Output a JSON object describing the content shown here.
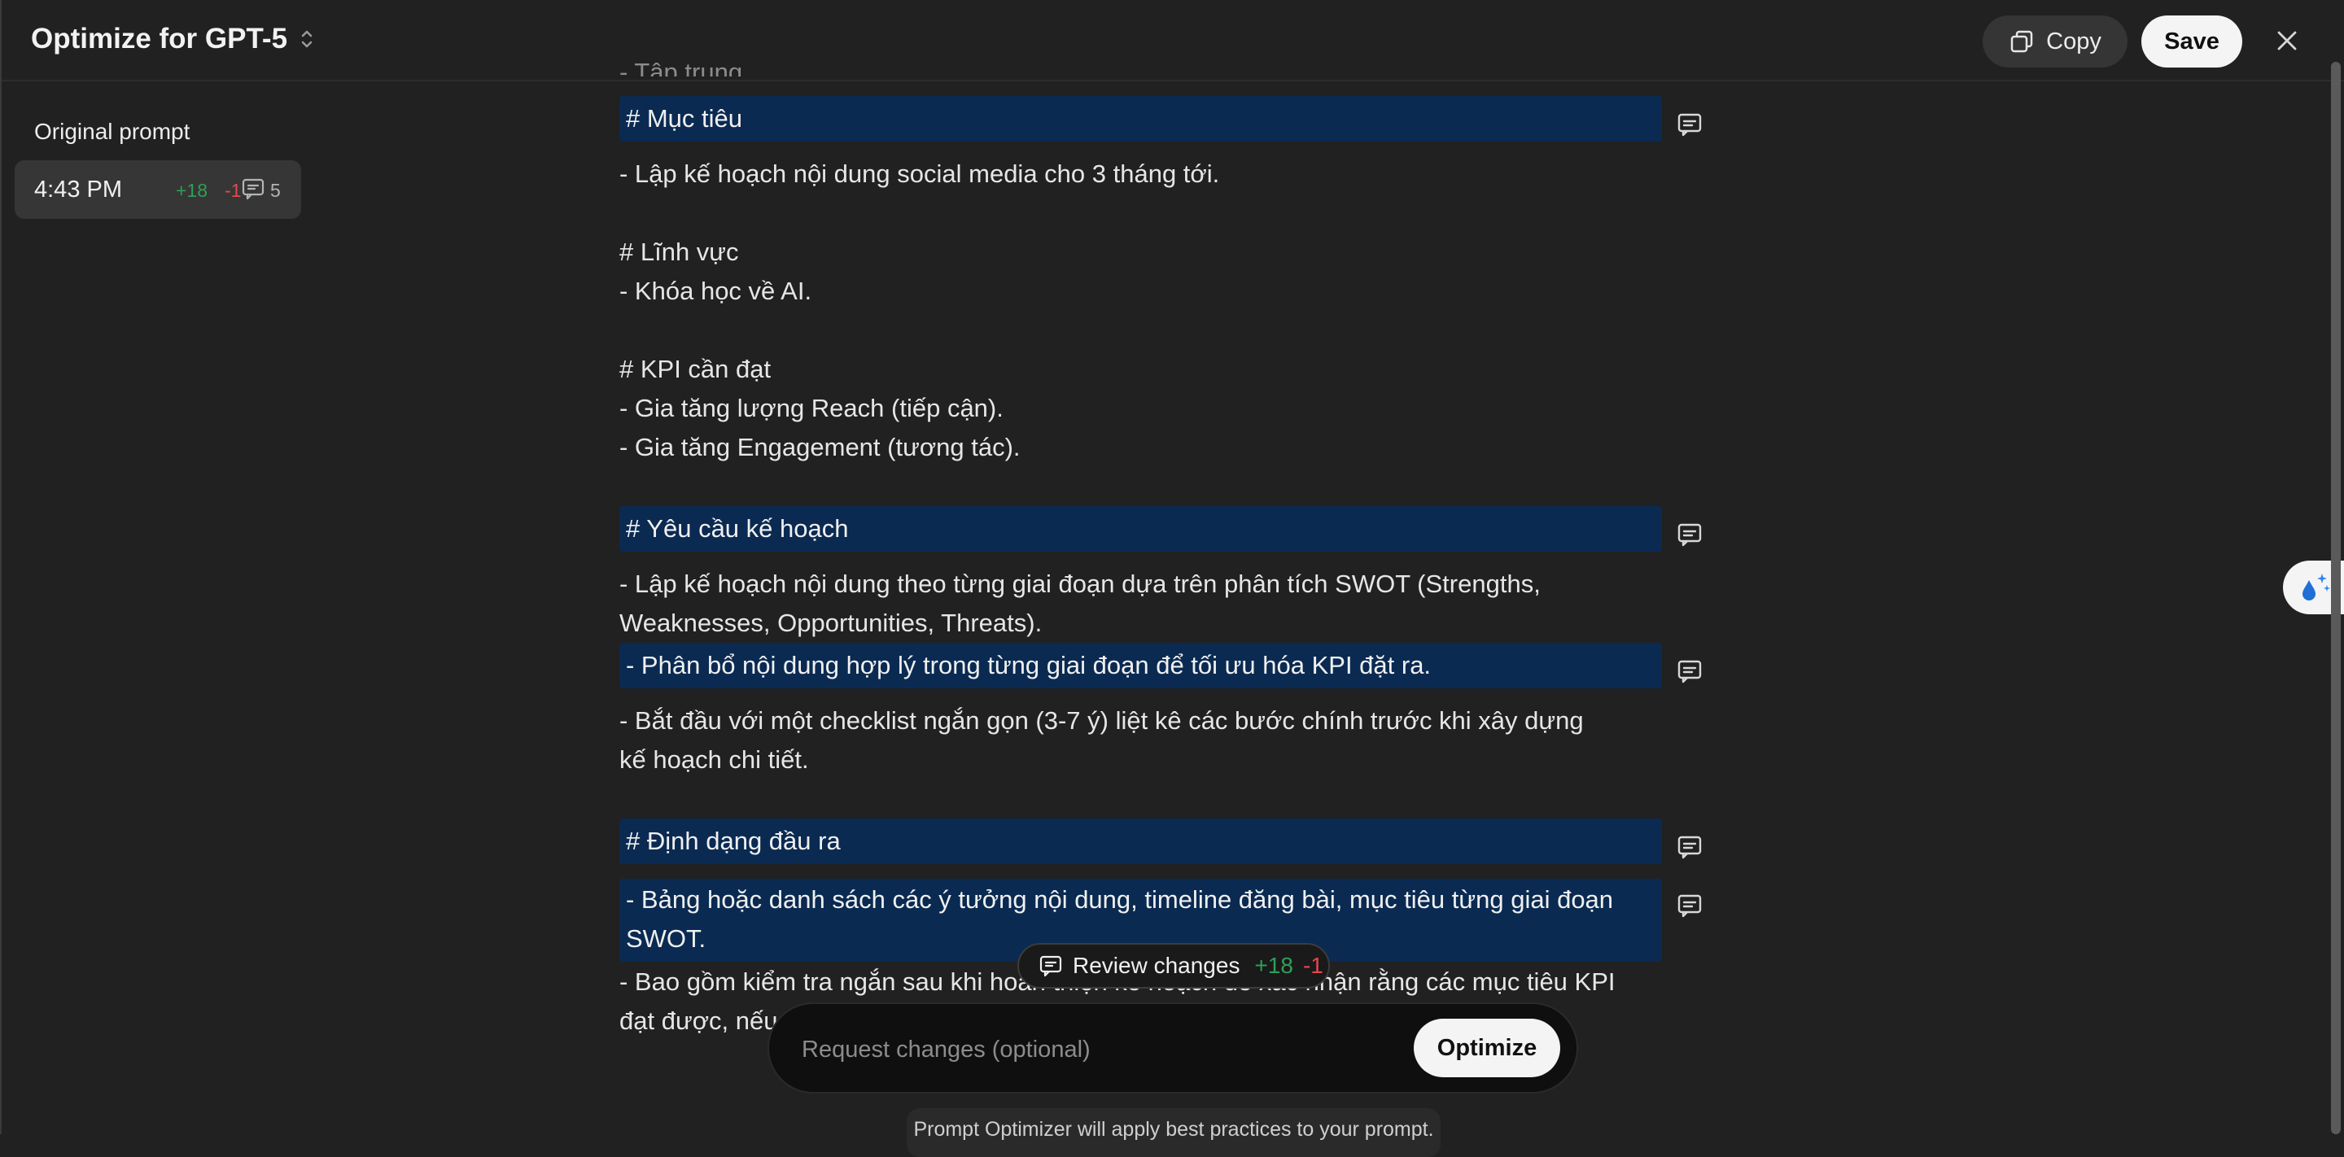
{
  "header": {
    "title": "Optimize for GPT-5",
    "copy_label": "Copy",
    "save_label": "Save"
  },
  "sidebar": {
    "original_label": "Original prompt",
    "versions": [
      {
        "time": "4:43 PM",
        "added": "+18",
        "removed": "-1",
        "comments": "5"
      }
    ]
  },
  "content": {
    "partial_top": "- Tập trung",
    "lines": [
      "# Mục tiêu",
      "- Lập kế hoạch nội dung social media cho 3 tháng tới.",
      "# Lĩnh vực",
      "- Khóa học về AI.",
      "# KPI cần đạt",
      "- Gia tăng lượng Reach (tiếp cận).",
      "- Gia tăng Engagement (tương tác).",
      "# Yêu cầu kế hoạch",
      "- Lập kế hoạch nội dung theo từng giai đoạn dựa trên phân tích SWOT (Strengths,",
      "Weaknesses, Opportunities, Threats).",
      "- Phân bổ nội dung hợp lý trong từng giai đoạn để tối ưu hóa KPI đặt ra.",
      "- Bắt đầu với một checklist ngắn gọn (3-7 ý) liệt kê các bước chính trước khi xây dựng",
      "kế hoạch chi tiết.",
      "# Định dạng đầu ra",
      "- Bảng hoặc danh sách các ý tưởng nội dung, timeline đăng bài, mục tiêu từng giai đoạn",
      "SWOT.",
      "- Bao gồm kiểm tra ngắn sau khi hoàn thiện kế hoạch để xác nhận rằng các mục tiêu KPI",
      "đạt được, nếu"
    ]
  },
  "review": {
    "label": "Review changes",
    "added": "+18",
    "removed": "-1"
  },
  "request": {
    "placeholder": "Request changes (optional)",
    "optimize_label": "Optimize"
  },
  "footer_note": "Prompt Optimizer will apply best practices to your prompt.",
  "colors": {
    "background": "#212121",
    "highlight": "#0a2a52",
    "added": "#2f9e57",
    "removed": "#e5484d"
  }
}
